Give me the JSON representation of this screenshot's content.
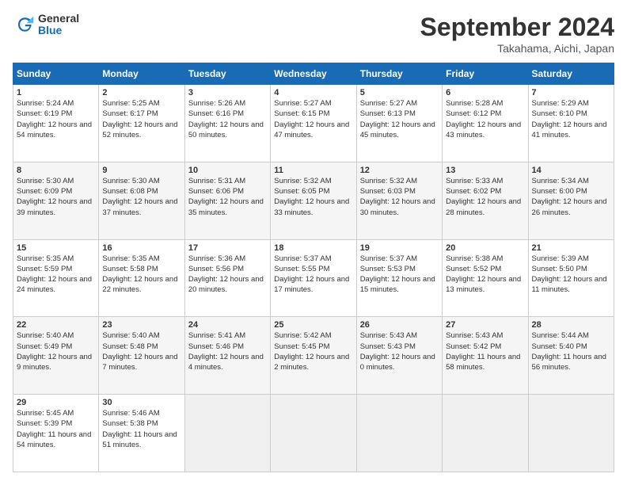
{
  "logo": {
    "general": "General",
    "blue": "Blue"
  },
  "header": {
    "title": "September 2024",
    "location": "Takahama, Aichi, Japan"
  },
  "weekdays": [
    "Sunday",
    "Monday",
    "Tuesday",
    "Wednesday",
    "Thursday",
    "Friday",
    "Saturday"
  ],
  "weeks": [
    [
      {
        "day": "1",
        "sunrise": "5:24 AM",
        "sunset": "6:19 PM",
        "daylight": "12 hours and 54 minutes."
      },
      {
        "day": "2",
        "sunrise": "5:25 AM",
        "sunset": "6:17 PM",
        "daylight": "12 hours and 52 minutes."
      },
      {
        "day": "3",
        "sunrise": "5:26 AM",
        "sunset": "6:16 PM",
        "daylight": "12 hours and 50 minutes."
      },
      {
        "day": "4",
        "sunrise": "5:27 AM",
        "sunset": "6:15 PM",
        "daylight": "12 hours and 47 minutes."
      },
      {
        "day": "5",
        "sunrise": "5:27 AM",
        "sunset": "6:13 PM",
        "daylight": "12 hours and 45 minutes."
      },
      {
        "day": "6",
        "sunrise": "5:28 AM",
        "sunset": "6:12 PM",
        "daylight": "12 hours and 43 minutes."
      },
      {
        "day": "7",
        "sunrise": "5:29 AM",
        "sunset": "6:10 PM",
        "daylight": "12 hours and 41 minutes."
      }
    ],
    [
      {
        "day": "8",
        "sunrise": "5:30 AM",
        "sunset": "6:09 PM",
        "daylight": "12 hours and 39 minutes."
      },
      {
        "day": "9",
        "sunrise": "5:30 AM",
        "sunset": "6:08 PM",
        "daylight": "12 hours and 37 minutes."
      },
      {
        "day": "10",
        "sunrise": "5:31 AM",
        "sunset": "6:06 PM",
        "daylight": "12 hours and 35 minutes."
      },
      {
        "day": "11",
        "sunrise": "5:32 AM",
        "sunset": "6:05 PM",
        "daylight": "12 hours and 33 minutes."
      },
      {
        "day": "12",
        "sunrise": "5:32 AM",
        "sunset": "6:03 PM",
        "daylight": "12 hours and 30 minutes."
      },
      {
        "day": "13",
        "sunrise": "5:33 AM",
        "sunset": "6:02 PM",
        "daylight": "12 hours and 28 minutes."
      },
      {
        "day": "14",
        "sunrise": "5:34 AM",
        "sunset": "6:00 PM",
        "daylight": "12 hours and 26 minutes."
      }
    ],
    [
      {
        "day": "15",
        "sunrise": "5:35 AM",
        "sunset": "5:59 PM",
        "daylight": "12 hours and 24 minutes."
      },
      {
        "day": "16",
        "sunrise": "5:35 AM",
        "sunset": "5:58 PM",
        "daylight": "12 hours and 22 minutes."
      },
      {
        "day": "17",
        "sunrise": "5:36 AM",
        "sunset": "5:56 PM",
        "daylight": "12 hours and 20 minutes."
      },
      {
        "day": "18",
        "sunrise": "5:37 AM",
        "sunset": "5:55 PM",
        "daylight": "12 hours and 17 minutes."
      },
      {
        "day": "19",
        "sunrise": "5:37 AM",
        "sunset": "5:53 PM",
        "daylight": "12 hours and 15 minutes."
      },
      {
        "day": "20",
        "sunrise": "5:38 AM",
        "sunset": "5:52 PM",
        "daylight": "12 hours and 13 minutes."
      },
      {
        "day": "21",
        "sunrise": "5:39 AM",
        "sunset": "5:50 PM",
        "daylight": "12 hours and 11 minutes."
      }
    ],
    [
      {
        "day": "22",
        "sunrise": "5:40 AM",
        "sunset": "5:49 PM",
        "daylight": "12 hours and 9 minutes."
      },
      {
        "day": "23",
        "sunrise": "5:40 AM",
        "sunset": "5:48 PM",
        "daylight": "12 hours and 7 minutes."
      },
      {
        "day": "24",
        "sunrise": "5:41 AM",
        "sunset": "5:46 PM",
        "daylight": "12 hours and 4 minutes."
      },
      {
        "day": "25",
        "sunrise": "5:42 AM",
        "sunset": "5:45 PM",
        "daylight": "12 hours and 2 minutes."
      },
      {
        "day": "26",
        "sunrise": "5:43 AM",
        "sunset": "5:43 PM",
        "daylight": "12 hours and 0 minutes."
      },
      {
        "day": "27",
        "sunrise": "5:43 AM",
        "sunset": "5:42 PM",
        "daylight": "11 hours and 58 minutes."
      },
      {
        "day": "28",
        "sunrise": "5:44 AM",
        "sunset": "5:40 PM",
        "daylight": "11 hours and 56 minutes."
      }
    ],
    [
      {
        "day": "29",
        "sunrise": "5:45 AM",
        "sunset": "5:39 PM",
        "daylight": "11 hours and 54 minutes."
      },
      {
        "day": "30",
        "sunrise": "5:46 AM",
        "sunset": "5:38 PM",
        "daylight": "11 hours and 51 minutes."
      },
      null,
      null,
      null,
      null,
      null
    ]
  ]
}
